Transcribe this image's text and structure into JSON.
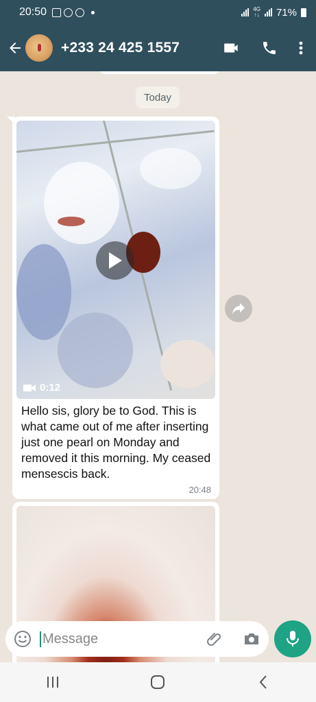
{
  "status_bar": {
    "time": "20:50",
    "battery": "71%"
  },
  "header": {
    "contact_name": "+233 24 425 1557",
    "back_icon": "arrow-left-icon",
    "video_icon": "video-camera-icon",
    "call_icon": "phone-icon",
    "menu_icon": "more-vert-icon"
  },
  "chat": {
    "date_label": "Today",
    "messages": [
      {
        "type": "video",
        "duration": "0:12",
        "caption": "Hello sis, glory be to God. This is what came out of me after inserting just one pearl on Monday and removed it this morning. My ceased mensescis back.",
        "time": "20:48"
      },
      {
        "type": "image"
      }
    ]
  },
  "input": {
    "placeholder": "Message"
  },
  "colors": {
    "header_bg": "#2f4f5c",
    "chat_bg": "#ece5dd",
    "accent": "#1ea385"
  }
}
